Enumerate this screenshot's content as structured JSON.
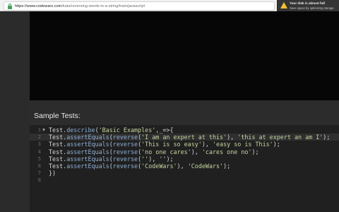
{
  "browser": {
    "url_host": "https://www.codewars.com",
    "url_path": "/kata/reversing-words-in-a-string/train/javascript",
    "icons": [
      "lock-icon",
      "star-icon",
      "extension-icon",
      "menu-icon"
    ]
  },
  "notification": {
    "icon": "warning-icon",
    "title": "Your disk is almost full",
    "message": "Save space by optimizing storage."
  },
  "sample_tests": {
    "header": "Sample Tests:",
    "active_line": 2,
    "lines": [
      {
        "number": "1",
        "fold": true,
        "parts": [
          {
            "text": "Test",
            "kind": "obj"
          },
          {
            "text": ".",
            "kind": "punc"
          },
          {
            "text": "describe",
            "kind": "fn"
          },
          {
            "text": "(",
            "kind": "punc"
          },
          {
            "text": "'Basic Examples'",
            "kind": "str"
          },
          {
            "text": ",_=>{",
            "kind": "punc"
          }
        ]
      },
      {
        "number": "2",
        "parts": [
          {
            "text": "Test",
            "kind": "obj"
          },
          {
            "text": ".",
            "kind": "punc"
          },
          {
            "text": "assertEquals",
            "kind": "fn"
          },
          {
            "text": "(",
            "kind": "punc"
          },
          {
            "text": "reverse",
            "kind": "fn"
          },
          {
            "text": "(",
            "kind": "punc"
          },
          {
            "text": "'I am an expert at this'",
            "kind": "str"
          },
          {
            "text": "), ",
            "kind": "punc"
          },
          {
            "text": "'this at expert an am I'",
            "kind": "str"
          },
          {
            "text": ");",
            "kind": "punc"
          }
        ]
      },
      {
        "number": "3",
        "parts": [
          {
            "text": "Test",
            "kind": "obj"
          },
          {
            "text": ".",
            "kind": "punc"
          },
          {
            "text": "assertEquals",
            "kind": "fn"
          },
          {
            "text": "(",
            "kind": "punc"
          },
          {
            "text": "reverse",
            "kind": "fn"
          },
          {
            "text": "(",
            "kind": "punc"
          },
          {
            "text": "'This is so easy'",
            "kind": "str"
          },
          {
            "text": "), ",
            "kind": "punc"
          },
          {
            "text": "'easy so is This'",
            "kind": "str"
          },
          {
            "text": ");",
            "kind": "punc"
          }
        ]
      },
      {
        "number": "4",
        "parts": [
          {
            "text": "Test",
            "kind": "obj"
          },
          {
            "text": ".",
            "kind": "punc"
          },
          {
            "text": "assertEquals",
            "kind": "fn"
          },
          {
            "text": "(",
            "kind": "punc"
          },
          {
            "text": "reverse",
            "kind": "fn"
          },
          {
            "text": "(",
            "kind": "punc"
          },
          {
            "text": "'no one cares'",
            "kind": "str"
          },
          {
            "text": "), ",
            "kind": "punc"
          },
          {
            "text": "'cares one no'",
            "kind": "str"
          },
          {
            "text": ");",
            "kind": "punc"
          }
        ]
      },
      {
        "number": "5",
        "parts": [
          {
            "text": "Test",
            "kind": "obj"
          },
          {
            "text": ".",
            "kind": "punc"
          },
          {
            "text": "assertEquals",
            "kind": "fn"
          },
          {
            "text": "(",
            "kind": "punc"
          },
          {
            "text": "reverse",
            "kind": "fn"
          },
          {
            "text": "(",
            "kind": "punc"
          },
          {
            "text": "''",
            "kind": "str"
          },
          {
            "text": "), ",
            "kind": "punc"
          },
          {
            "text": "''",
            "kind": "str"
          },
          {
            "text": ");",
            "kind": "punc"
          }
        ]
      },
      {
        "number": "6",
        "parts": [
          {
            "text": "Test",
            "kind": "obj"
          },
          {
            "text": ".",
            "kind": "punc"
          },
          {
            "text": "assertEquals",
            "kind": "fn"
          },
          {
            "text": "(",
            "kind": "punc"
          },
          {
            "text": "reverse",
            "kind": "fn"
          },
          {
            "text": "(",
            "kind": "punc"
          },
          {
            "text": "'CodeWars'",
            "kind": "str"
          },
          {
            "text": "), ",
            "kind": "punc"
          },
          {
            "text": "'CodeWars'",
            "kind": "str"
          },
          {
            "text": ");",
            "kind": "punc"
          }
        ]
      },
      {
        "number": "7",
        "parts": [
          {
            "text": "})",
            "kind": "punc"
          }
        ]
      },
      {
        "number": "8",
        "parts": []
      }
    ]
  },
  "colors": {
    "editor_bg": "#202020",
    "string": "#c6d6a0",
    "function": "#8fb0d6",
    "warning": "#f2c230"
  }
}
